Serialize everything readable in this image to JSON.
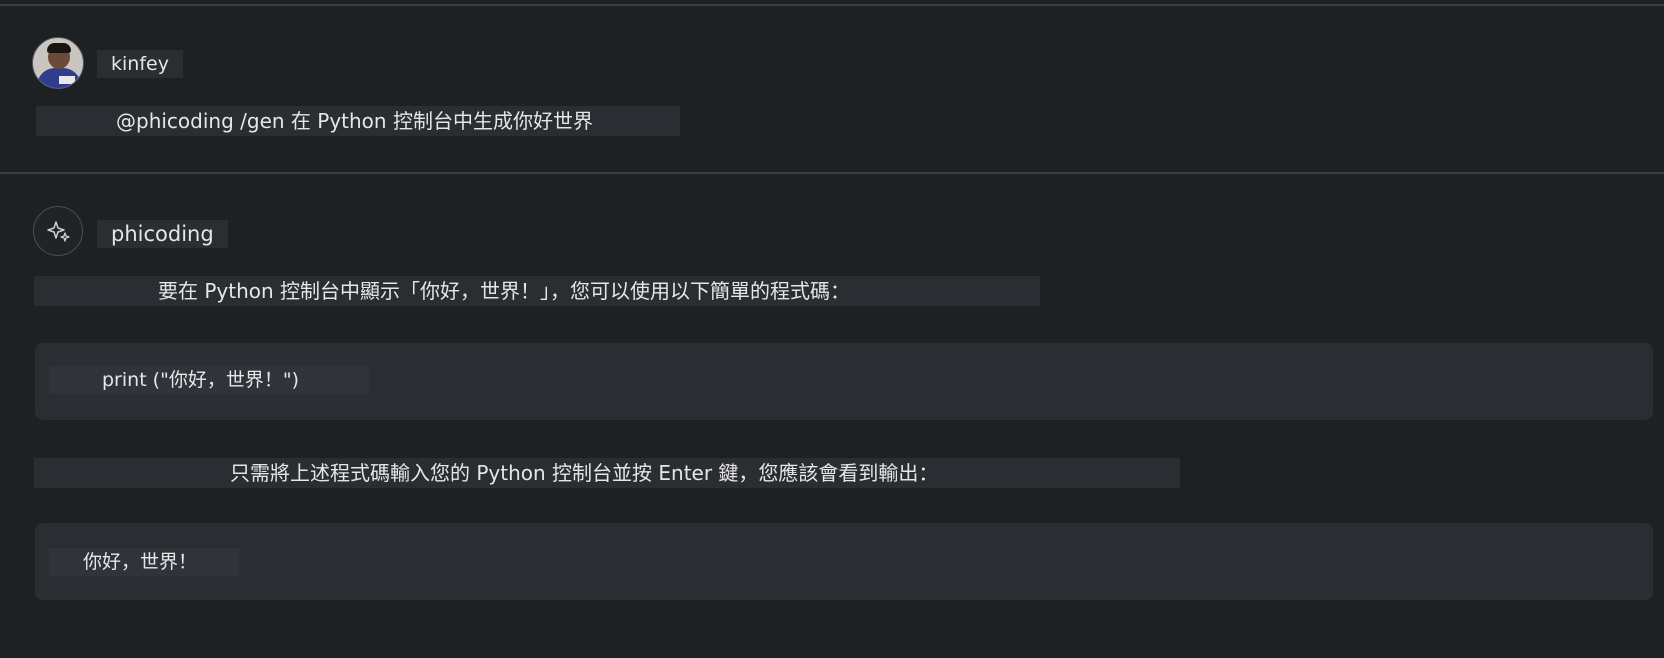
{
  "user": {
    "name": "kinfey",
    "message": "@phicoding /gen 在 Python 控制台中生成你好世界"
  },
  "bot": {
    "name": "phicoding",
    "icon": "sparkle-icon",
    "line1": "要在 Python 控制台中顯示「你好，世界！」，您可以使用以下簡單的程式碼：",
    "code1": "print (\"你好，世界！\")",
    "line2": "只需將上述程式碼輸入您的 Python 控制台並按 Enter 鍵，您應該會看到輸出：",
    "code2": "你好，世界！"
  },
  "colors": {
    "background": "#1e2124",
    "panel": "#2a2d31",
    "text": "#e6e6e6",
    "divider": "#3a3d41"
  }
}
